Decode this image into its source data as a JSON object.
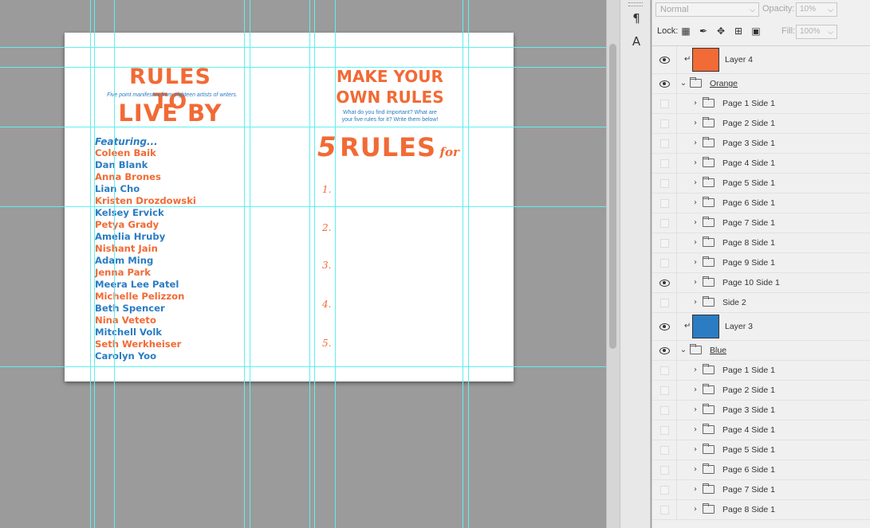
{
  "document": {
    "left_page": {
      "title_line1": "RULES TO",
      "subtitle": "Five point manifestos from eighteen artists of writers.",
      "title_line2": "LIVE BY",
      "featuring": "Featuring...",
      "names": [
        {
          "text": "Coleen Baik",
          "color": "orange"
        },
        {
          "text": "Dan Blank",
          "color": "blue"
        },
        {
          "text": "Anna Brones",
          "color": "orange"
        },
        {
          "text": "Lian Cho",
          "color": "blue"
        },
        {
          "text": "Kristen Drozdowski",
          "color": "orange"
        },
        {
          "text": "Kelsey Ervick",
          "color": "blue"
        },
        {
          "text": "Petya Grady",
          "color": "orange"
        },
        {
          "text": "Amelia Hruby",
          "color": "blue"
        },
        {
          "text": "Nishant Jain",
          "color": "orange"
        },
        {
          "text": "Adam Ming",
          "color": "blue"
        },
        {
          "text": "Jenna Park",
          "color": "orange"
        },
        {
          "text": "Meera Lee Patel",
          "color": "blue"
        },
        {
          "text": "Michelle Pelizzon",
          "color": "orange"
        },
        {
          "text": "Beth Spencer",
          "color": "blue"
        },
        {
          "text": "Nina Veteto",
          "color": "orange"
        },
        {
          "text": "Mitchell Volk",
          "color": "blue"
        },
        {
          "text": "Seth Werkheiser",
          "color": "orange"
        },
        {
          "text": "Carolyn Yoo",
          "color": "blue"
        }
      ]
    },
    "right_page": {
      "title_line1": "MAKE YOUR",
      "title_line2": "OWN RULES",
      "sub_line1": "What do you find important? What are",
      "sub_line2": "your five rules for it? Write them below!",
      "rules_number": "5",
      "rules_word": "RULES",
      "rules_for": "for",
      "rule_numbers": [
        "1.",
        "2.",
        "3.",
        "4.",
        "5."
      ]
    },
    "colors": {
      "orange": "#f26a35",
      "blue": "#2b7cc3",
      "guide": "#5ff0ef"
    }
  },
  "panel": {
    "blend_mode": "Normal",
    "opacity_label": "Opacity:",
    "opacity_value": "10%",
    "lock_label": "Lock:",
    "fill_label": "Fill:",
    "fill_value": "100%",
    "layers": [
      {
        "name": "Layer 4",
        "type": "fill",
        "visible": true,
        "color": "#f26a35"
      },
      {
        "name": "Orange",
        "type": "group-open",
        "visible": true
      },
      {
        "name": "Page 1 Side 1",
        "type": "group",
        "visible": false
      },
      {
        "name": "Page 2 Side 1",
        "type": "group",
        "visible": false
      },
      {
        "name": "Page 3 Side 1",
        "type": "group",
        "visible": false
      },
      {
        "name": "Page 4 Side 1",
        "type": "group",
        "visible": false
      },
      {
        "name": "Page 5 Side 1",
        "type": "group",
        "visible": false
      },
      {
        "name": "Page 6 Side 1",
        "type": "group",
        "visible": false
      },
      {
        "name": "Page 7 Side 1",
        "type": "group",
        "visible": false
      },
      {
        "name": "Page 8 Side 1",
        "type": "group",
        "visible": false
      },
      {
        "name": "Page 9 Side 1",
        "type": "group",
        "visible": false
      },
      {
        "name": "Page 10 Side 1",
        "type": "group",
        "visible": true
      },
      {
        "name": "Side 2",
        "type": "group",
        "visible": false
      },
      {
        "name": "Layer 3",
        "type": "fill",
        "visible": true,
        "color": "#2b7cc3"
      },
      {
        "name": "Blue",
        "type": "group-open",
        "visible": true
      },
      {
        "name": "Page 1 Side 1",
        "type": "group",
        "visible": false
      },
      {
        "name": "Page 2 Side 1",
        "type": "group",
        "visible": false
      },
      {
        "name": "Page 3 Side 1",
        "type": "group",
        "visible": false
      },
      {
        "name": "Page 4 Side 1",
        "type": "group",
        "visible": false
      },
      {
        "name": "Page 5 Side 1",
        "type": "group",
        "visible": false
      },
      {
        "name": "Page 6 Side 1",
        "type": "group",
        "visible": false
      },
      {
        "name": "Page 7 Side 1",
        "type": "group",
        "visible": false
      },
      {
        "name": "Page 8 Side 1",
        "type": "group",
        "visible": false
      }
    ]
  }
}
